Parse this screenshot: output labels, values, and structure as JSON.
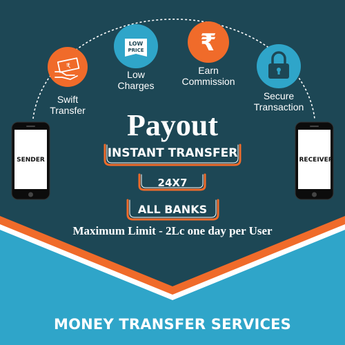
{
  "features": [
    {
      "id": "swift",
      "label_line1": "Swift",
      "label_line2": "Transfer",
      "icon": "hand-cash-icon"
    },
    {
      "id": "low",
      "label_line1": "Low",
      "label_line2": "Charges",
      "icon": "low-price-tag-icon",
      "badge_line1": "LOW",
      "badge_line2": "PRICE"
    },
    {
      "id": "earn",
      "label_line1": "Earn",
      "label_line2": "Commission",
      "icon": "rupee-icon",
      "symbol": "₹"
    },
    {
      "id": "secure",
      "label_line1": "Secure",
      "label_line2": "Transaction",
      "icon": "padlock-icon"
    }
  ],
  "sender_label": "SENDER",
  "receiver_label": "RECEIVER",
  "title": "Payout",
  "pills": {
    "instant": "INSTANT TRANSFER",
    "hours": "24X7",
    "banks": "ALL BANKS"
  },
  "limit_text": "Maximum Limit - 2Lc one day per User",
  "footer": "MONEY TRANSFER SERVICES",
  "colors": {
    "dark_teal": "#1d4755",
    "light_blue": "#2fa5c9",
    "orange": "#f06b2a",
    "white": "#ffffff"
  }
}
